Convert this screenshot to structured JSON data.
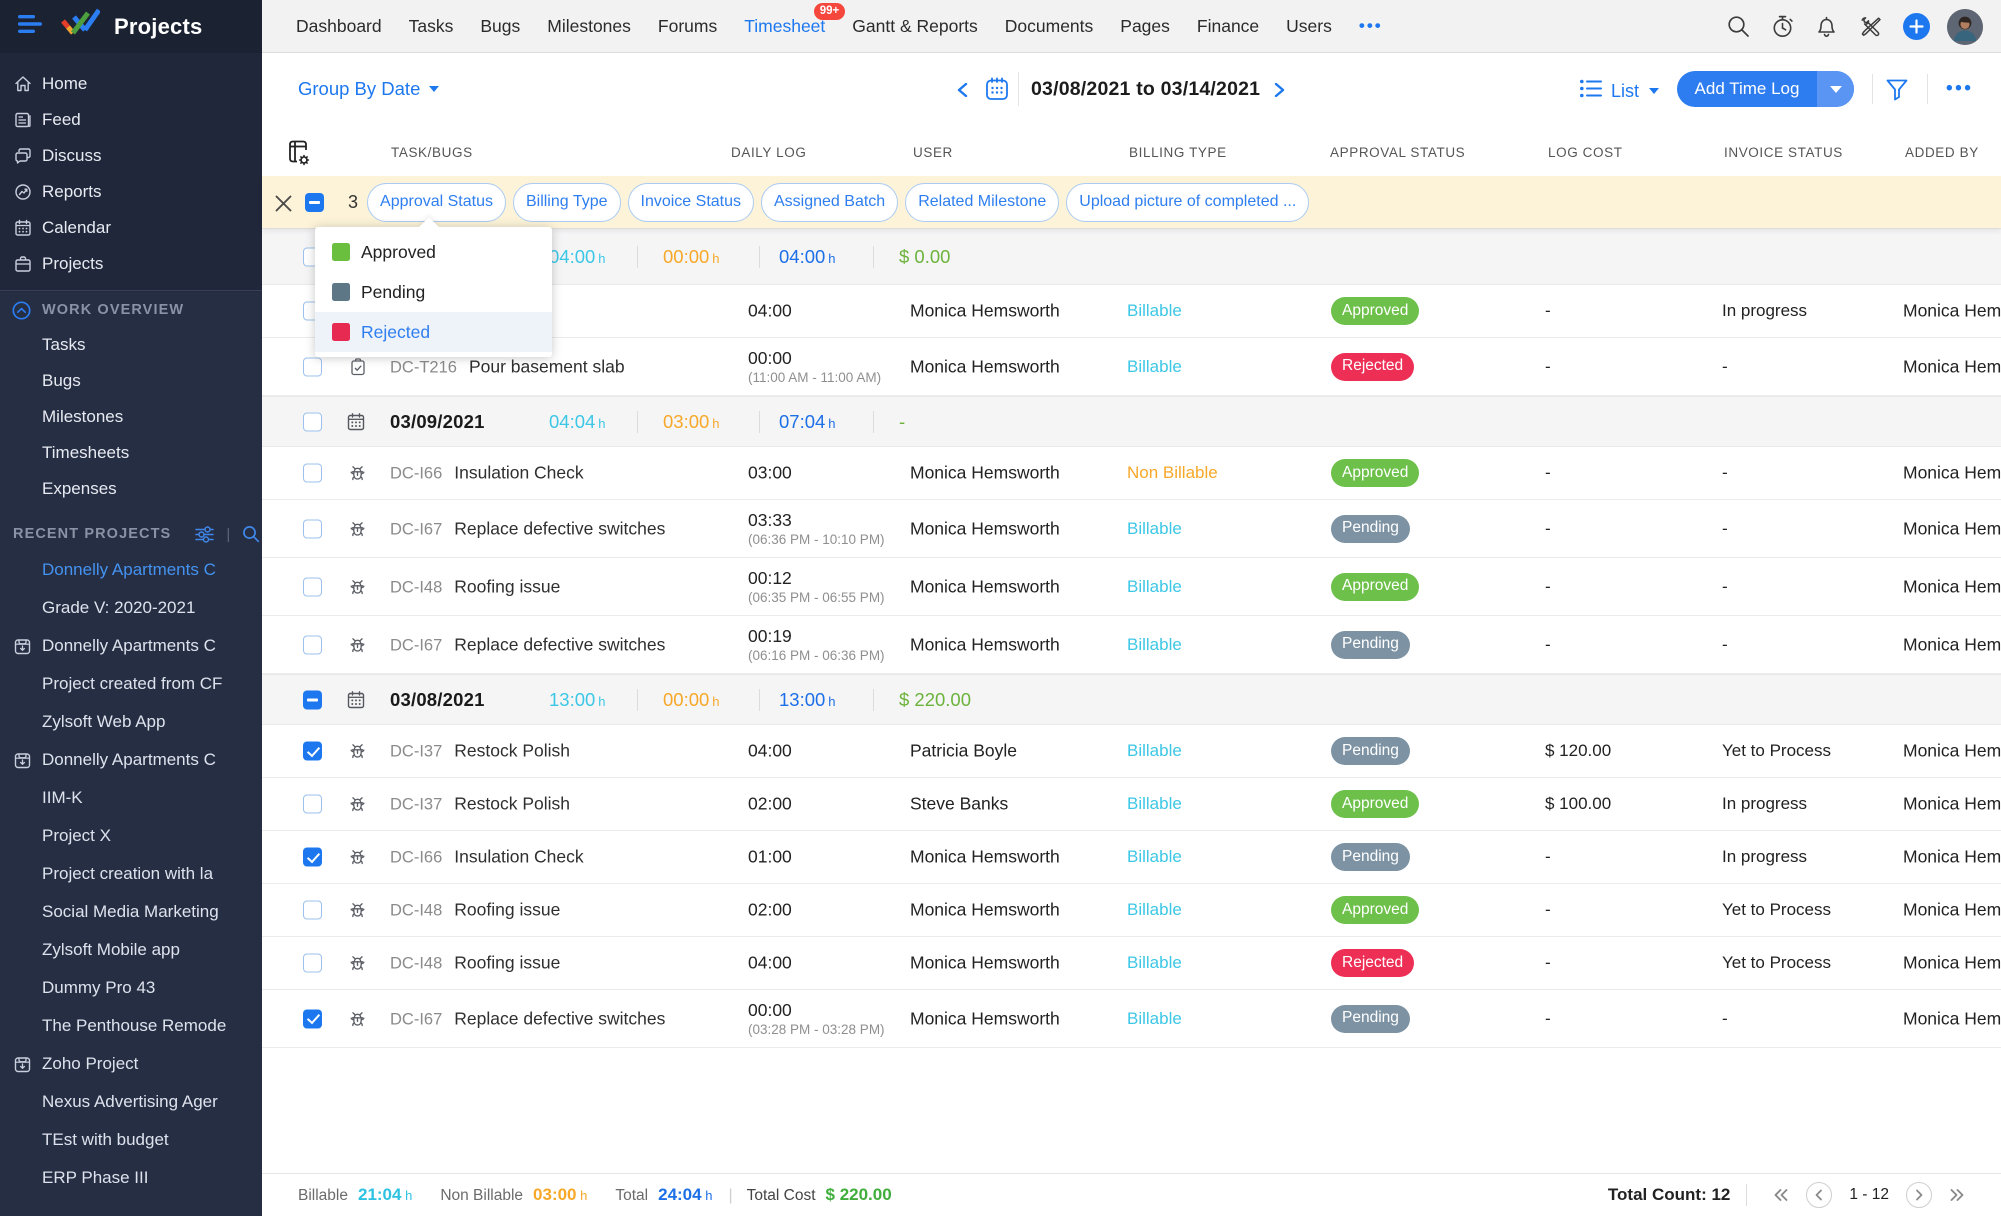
{
  "brand": {
    "name": "Projects"
  },
  "topnav": {
    "items": [
      {
        "label": "Dashboard"
      },
      {
        "label": "Tasks"
      },
      {
        "label": "Bugs"
      },
      {
        "label": "Milestones"
      },
      {
        "label": "Forums"
      },
      {
        "label": "Timesheet",
        "active": true,
        "badge": "99+"
      },
      {
        "label": "Gantt & Reports"
      },
      {
        "label": "Documents"
      },
      {
        "label": "Pages"
      },
      {
        "label": "Finance"
      },
      {
        "label": "Users"
      }
    ],
    "more_label": "•••",
    "right_icons": [
      "search-icon",
      "timer-icon",
      "bell-icon",
      "tools-icon",
      "plus-icon",
      "avatar"
    ]
  },
  "sidebar": {
    "main_items": [
      {
        "label": "Home",
        "icon": "home-icon"
      },
      {
        "label": "Feed",
        "icon": "feed-icon"
      },
      {
        "label": "Discuss",
        "icon": "discuss-icon"
      },
      {
        "label": "Reports",
        "icon": "reports-icon"
      },
      {
        "label": "Calendar",
        "icon": "calendar-icon"
      },
      {
        "label": "Projects",
        "icon": "projects-icon"
      }
    ],
    "work_overview": {
      "label": "WORK OVERVIEW",
      "icon": "chevron-up-circle-icon",
      "items": [
        "Tasks",
        "Bugs",
        "Milestones",
        "Timesheets",
        "Expenses"
      ]
    },
    "recent_projects": {
      "label": "RECENT PROJECTS",
      "header_icons": [
        "sliders-icon",
        "search-icon"
      ],
      "items": [
        {
          "label": "Donnelly Apartments C",
          "active": true
        },
        {
          "label": "Grade V: 2020-2021"
        },
        {
          "label": "Donnelly Apartments C",
          "icon": "project-box-icon"
        },
        {
          "label": "Project created from CF"
        },
        {
          "label": "Zylsoft Web App"
        },
        {
          "label": "Donnelly Apartments C",
          "icon": "project-box-icon"
        },
        {
          "label": "IIM-K"
        },
        {
          "label": "Project X"
        },
        {
          "label": "Project creation with la"
        },
        {
          "label": "Social Media Marketing"
        },
        {
          "label": "Zylsoft Mobile app"
        },
        {
          "label": "Dummy Pro 43"
        },
        {
          "label": "The Penthouse Remode"
        },
        {
          "label": "Zoho Project",
          "icon": "project-box-icon"
        },
        {
          "label": "Nexus Advertising Ager"
        },
        {
          "label": "TEst with budget"
        },
        {
          "label": "ERP Phase III"
        }
      ]
    }
  },
  "toolbar": {
    "group_by_label": "Group By Date",
    "date_range": "03/08/2021 to 03/14/2021",
    "view_label": "List",
    "add_button_label": "Add Time Log",
    "more_label": "•••"
  },
  "filter_bar": {
    "count": "3",
    "chips": [
      "Approval Status",
      "Billing Type",
      "Invoice Status",
      "Assigned Batch",
      "Related Milestone",
      "Upload picture of completed ..."
    ]
  },
  "approval_dropdown": {
    "items": [
      {
        "label": "Approved",
        "color": "#6abf3f",
        "selected": false
      },
      {
        "label": "Pending",
        "color": "#5d7787",
        "selected": false
      },
      {
        "label": "Rejected",
        "color": "#e62a52",
        "selected": true
      }
    ]
  },
  "table": {
    "columns": [
      "TASK/BUGS",
      "DAILY LOG",
      "USER",
      "BILLING TYPE",
      "APPROVAL STATUS",
      "LOG COST",
      "INVOICE STATUS",
      "ADDED BY"
    ],
    "groups": [
      {
        "date": "",
        "checkbox": "off",
        "billable": "04:00",
        "non_billable": "00:00",
        "total": "04:00",
        "cost": "$ 0.00",
        "rows": [
          {
            "checkbox": "off",
            "icon": "",
            "id": "",
            "name": "",
            "log": "04:00",
            "range": "",
            "user": "Monica Hemsworth",
            "billing": "Billable",
            "approval": "Approved",
            "cost": "-",
            "invoice": "In progress",
            "added_by": "Monica Hemsworth"
          },
          {
            "checkbox": "off",
            "icon": "task-icon",
            "id": "DC-T216",
            "name": "Pour basement slab",
            "log": "00:00",
            "range": "(11:00 AM - 11:00 AM)",
            "user": "Monica Hemsworth",
            "billing": "Billable",
            "approval": "Rejected",
            "cost": "-",
            "invoice": "-",
            "added_by": "Monica Hemsworth"
          }
        ]
      },
      {
        "date": "03/09/2021",
        "checkbox": "off",
        "billable": "04:04",
        "non_billable": "03:00",
        "total": "07:04",
        "cost": "-",
        "rows": [
          {
            "checkbox": "off",
            "icon": "bug-icon",
            "id": "DC-I66",
            "name": "Insulation Check",
            "log": "03:00",
            "range": "",
            "user": "Monica Hemsworth",
            "billing": "Non Billable",
            "approval": "Approved",
            "cost": "-",
            "invoice": "-",
            "added_by": "Monica Hemsworth"
          },
          {
            "checkbox": "off",
            "icon": "bug-icon",
            "id": "DC-I67",
            "name": "Replace defective switches",
            "log": "03:33",
            "range": "(06:36 PM - 10:10 PM)",
            "user": "Monica Hemsworth",
            "billing": "Billable",
            "approval": "Pending",
            "cost": "-",
            "invoice": "-",
            "added_by": "Monica Hemsworth"
          },
          {
            "checkbox": "off",
            "icon": "bug-icon",
            "id": "DC-I48",
            "name": "Roofing issue",
            "log": "00:12",
            "range": "(06:35 PM - 06:55 PM)",
            "user": "Monica Hemsworth",
            "billing": "Billable",
            "approval": "Approved",
            "cost": "-",
            "invoice": "-",
            "added_by": "Monica Hemsworth"
          },
          {
            "checkbox": "off",
            "icon": "bug-icon",
            "id": "DC-I67",
            "name": "Replace defective switches",
            "log": "00:19",
            "range": "(06:16 PM - 06:36 PM)",
            "user": "Monica Hemsworth",
            "billing": "Billable",
            "approval": "Pending",
            "cost": "-",
            "invoice": "-",
            "added_by": "Monica Hemsworth"
          }
        ]
      },
      {
        "date": "03/08/2021",
        "checkbox": "ind",
        "billable": "13:00",
        "non_billable": "00:00",
        "total": "13:00",
        "cost": "$ 220.00",
        "rows": [
          {
            "checkbox": "on",
            "icon": "bug-icon",
            "id": "DC-I37",
            "name": "Restock Polish",
            "log": "04:00",
            "range": "",
            "user": "Patricia Boyle",
            "billing": "Billable",
            "approval": "Pending",
            "cost": "$ 120.00",
            "invoice": "Yet to Process",
            "added_by": "Monica Hemsworth"
          },
          {
            "checkbox": "off",
            "icon": "bug-icon",
            "id": "DC-I37",
            "name": "Restock Polish",
            "log": "02:00",
            "range": "",
            "user": "Steve Banks",
            "billing": "Billable",
            "approval": "Approved",
            "cost": "$ 100.00",
            "invoice": "In progress",
            "added_by": "Monica Hemsworth"
          },
          {
            "checkbox": "on",
            "icon": "bug-icon",
            "id": "DC-I66",
            "name": "Insulation Check",
            "log": "01:00",
            "range": "",
            "user": "Monica Hemsworth",
            "billing": "Billable",
            "approval": "Pending",
            "cost": "-",
            "invoice": "In progress",
            "added_by": "Monica Hemsworth"
          },
          {
            "checkbox": "off",
            "icon": "bug-icon",
            "id": "DC-I48",
            "name": "Roofing issue",
            "log": "02:00",
            "range": "",
            "user": "Monica Hemsworth",
            "billing": "Billable",
            "approval": "Approved",
            "cost": "-",
            "invoice": "Yet to Process",
            "added_by": "Monica Hemsworth"
          },
          {
            "checkbox": "off",
            "icon": "bug-icon",
            "id": "DC-I48",
            "name": "Roofing issue",
            "log": "04:00",
            "range": "",
            "user": "Monica Hemsworth",
            "billing": "Billable",
            "approval": "Rejected",
            "cost": "-",
            "invoice": "Yet to Process",
            "added_by": "Monica Hemsworth"
          },
          {
            "checkbox": "on",
            "icon": "bug-icon",
            "id": "DC-I67",
            "name": "Replace defective switches",
            "log": "00:00",
            "range": "(03:28 PM - 03:28 PM)",
            "user": "Monica Hemsworth",
            "billing": "Billable",
            "approval": "Pending",
            "cost": "-",
            "invoice": "-",
            "added_by": "Monica Hemsworth"
          }
        ]
      }
    ]
  },
  "footer": {
    "billable_label": "Billable",
    "billable_value": "21:04",
    "non_billable_label": "Non Billable",
    "non_billable_value": "03:00",
    "total_label": "Total",
    "total_value": "24:04",
    "total_cost_label": "Total Cost",
    "total_cost_value": "$ 220.00",
    "total_count_label": "Total Count: 12",
    "page_range": "1 - 12"
  }
}
